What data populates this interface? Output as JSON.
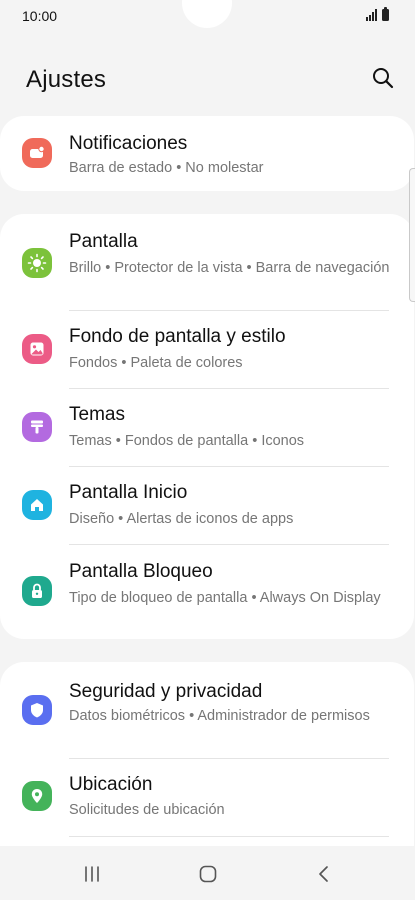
{
  "status_bar": {
    "time": "10:00"
  },
  "header": {
    "title": "Ajustes"
  },
  "groups": [
    {
      "items": [
        {
          "title": "Notificaciones",
          "subtitle": "Barra de estado  •  No molestar",
          "icon": "notification-icon",
          "color": "#f06a5a"
        }
      ]
    },
    {
      "items": [
        {
          "title": "Pantalla",
          "subtitle": "Brillo  •  Protector de la vista  •  Barra de navegación",
          "icon": "sun-icon",
          "color": "#7cc23b"
        },
        {
          "title": "Fondo de pantalla y estilo",
          "subtitle": "Fondos  •  Paleta de colores",
          "icon": "image-icon",
          "color": "#ec5b86"
        },
        {
          "title": "Temas",
          "subtitle": "Temas  •  Fondos de pantalla  •  Iconos",
          "icon": "brush-icon",
          "color": "#b36ae0"
        },
        {
          "title": "Pantalla Inicio",
          "subtitle": "Diseño  •  Alertas de iconos de apps",
          "icon": "home-icon",
          "color": "#1fb3e0"
        },
        {
          "title": "Pantalla Bloqueo",
          "subtitle": "Tipo de bloqueo de pantalla  •  Always On Display",
          "icon": "lock-icon",
          "color": "#1fa98e"
        }
      ]
    },
    {
      "items": [
        {
          "title": "Seguridad y privacidad",
          "subtitle": "Datos biométricos  •  Administrador de permisos",
          "icon": "shield-icon",
          "color": "#5a6ef0"
        },
        {
          "title": "Ubicación",
          "subtitle": "Solicitudes de ubicación",
          "icon": "location-pin-icon",
          "color": "#44b35a"
        }
      ]
    }
  ]
}
